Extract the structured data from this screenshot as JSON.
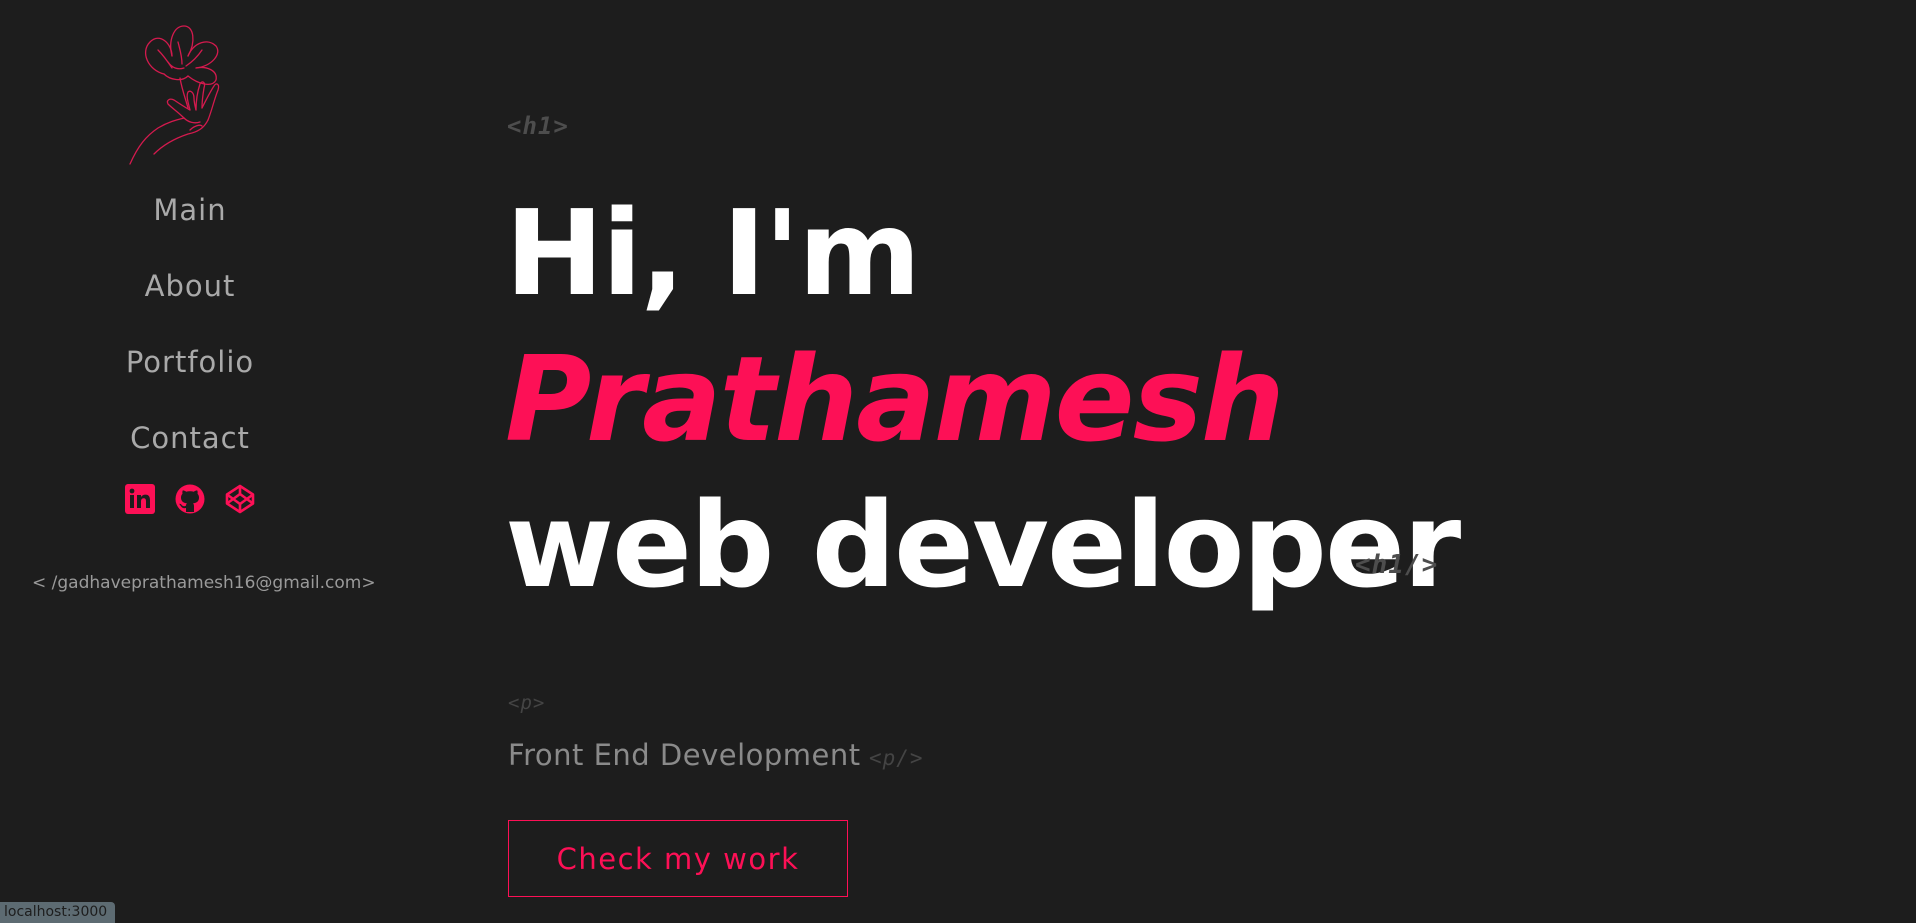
{
  "sidebar": {
    "nav": [
      {
        "label": "Main"
      },
      {
        "label": "About"
      },
      {
        "label": "Portfolio"
      },
      {
        "label": "Contact"
      }
    ],
    "socials": [
      "linkedin-icon",
      "github-icon",
      "codepen-icon"
    ],
    "email": "< /gadhaveprathamesh16@gmail.com>"
  },
  "hero": {
    "tag_h1_open": "<h1>",
    "line1": "Hi, I'm",
    "name": "Prathamesh",
    "line3": "web developer",
    "tag_h1_close": "<h1/>",
    "tag_p_open": "<p>",
    "subtitle": "Front End Development",
    "tag_p_close": "<p/>",
    "cta": "Check my work"
  },
  "statusbar": {
    "text": "localhost:3000"
  },
  "colors": {
    "accent": "#fd1056",
    "background": "#1d1d1d",
    "nav_text": "#a9a9a9"
  }
}
